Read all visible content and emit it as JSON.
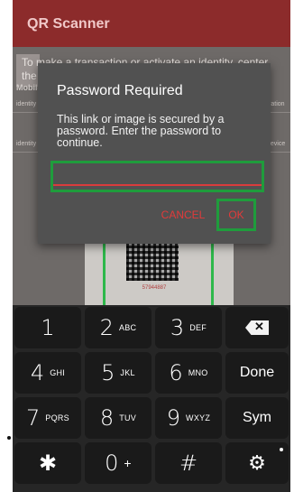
{
  "app": {
    "title": "QR Scanner",
    "instructions": "To make a transaction or activate an identity, center the QR code in the scan window below.",
    "tab_left": "Mobile",
    "tab_identity": "identity",
    "tab_right": "activation",
    "row2_left": "identity a",
    "row2_right": "device",
    "camera_code": "57944887"
  },
  "dialog": {
    "title": "Password Required",
    "message": "This link or image is secured by a password. Enter the password to continue.",
    "password_value": "",
    "cancel_label": "CANCEL",
    "ok_label": "OK"
  },
  "keyboard": {
    "keys": [
      {
        "main": "1",
        "sub": ""
      },
      {
        "main": "2",
        "sub": "ABC"
      },
      {
        "main": "3",
        "sub": "DEF"
      },
      {
        "main": "4",
        "sub": "GHI"
      },
      {
        "main": "5",
        "sub": "JKL"
      },
      {
        "main": "6",
        "sub": "MNO"
      },
      {
        "main": "7",
        "sub": "PQRS"
      },
      {
        "main": "8",
        "sub": "TUV"
      },
      {
        "main": "9",
        "sub": "WXYZ"
      },
      {
        "main": "✱",
        "sub": ""
      },
      {
        "main": "0",
        "sub": "+"
      },
      {
        "main": "#",
        "sub": ""
      }
    ],
    "done_label": "Done",
    "sym_label": "Sym",
    "backspace_icon": "backspace-icon",
    "settings_icon": "gear-icon"
  },
  "colors": {
    "appbar": "#8c2b2b",
    "accent_red": "#e23a3a",
    "focus_green": "#1f9c3c"
  }
}
